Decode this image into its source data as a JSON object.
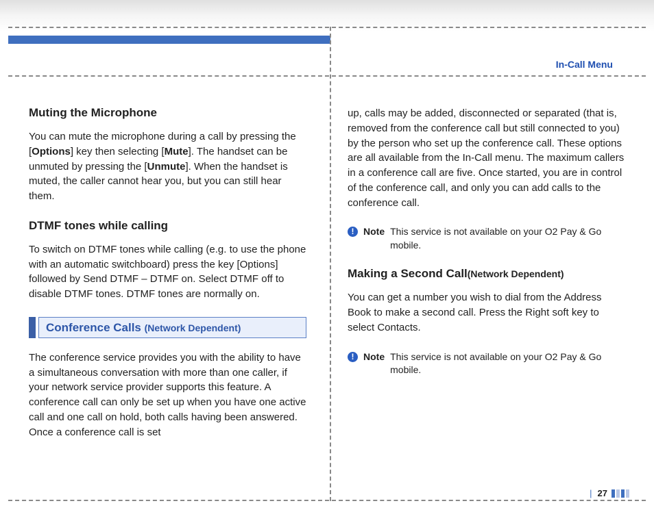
{
  "header": {
    "section_label": "In-Call Menu"
  },
  "left": {
    "h1": "Muting the Microphone",
    "p1_a": "You can mute the microphone during a call by pressing the [",
    "p1_b": "Options",
    "p1_c": "] key then selecting  [",
    "p1_d": "Mute",
    "p1_e": "]. The handset can be unmuted by pressing the [",
    "p1_f": "Unmute",
    "p1_g": "]. When the handset is muted, the caller cannot hear you, but you can still hear them.",
    "h2": "DTMF tones while calling",
    "p2": "To switch on DTMF tones while calling (e.g. to use the phone with an automatic switchboard) press the key [Options] followed by Send DTMF – DTMF on. Select DTMF off to disable DTMF tones. DTMF tones are normally on.",
    "box_title": "Conference Calls ",
    "box_sub": "(Network Dependent)",
    "p3": "The conference service provides you with the ability to have a simultaneous conversation with more than one caller, if your network service provider supports this feature. A conference call can only be set up when you have one active call and one call on hold, both calls having been answered. Once a conference call is set"
  },
  "right": {
    "p1": "up, calls may be added, disconnected or separated (that is, removed from the conference call but still connected to you) by the person who set up the conference call. These options are all available from the In-Call menu. The maximum callers in a conference call are five. Once started, you are in control of the conference  call, and only you can add calls to the conference call.",
    "note1_label": "Note",
    "note1_text": "This service is not available on your O2 Pay & Go mobile.",
    "h1_a": "Making a Second Call",
    "h1_b": "(Network Dependent)",
    "p2": "You can get a number you wish to dial from the Address Book to make a second call. Press the Right soft key to select Contacts.",
    "note2_label": "Note",
    "note2_text": "This service is not available on your O2 Pay & Go mobile."
  },
  "footer": {
    "page": "27"
  }
}
